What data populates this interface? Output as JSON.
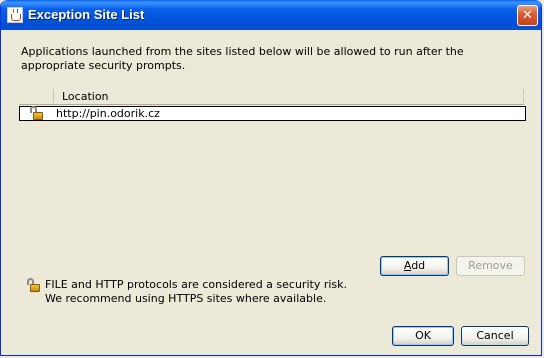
{
  "window": {
    "title": "Exception Site List",
    "app_icon": "java-cup-icon",
    "close_icon": "close-icon"
  },
  "description": "Applications launched from the sites listed below will be allowed to run after the appropriate security prompts.",
  "table": {
    "columns": [
      "",
      "Location"
    ],
    "rows": [
      {
        "icon": "unlocked-padlock-icon",
        "location": "http://pin.odorik.cz"
      }
    ]
  },
  "buttons": {
    "add_mnemonic": "A",
    "add_rest": "dd",
    "remove": "Remove",
    "ok": "OK",
    "cancel": "Cancel"
  },
  "warning": {
    "icon": "unlocked-padlock-icon",
    "line1": "FILE and HTTP protocols are considered a security risk.",
    "line2": "We recommend using HTTPS sites where available."
  },
  "colors": {
    "titlebar": "#0a5fe9",
    "dialog_bg": "#ece9d8",
    "close_button": "#c8401c"
  }
}
